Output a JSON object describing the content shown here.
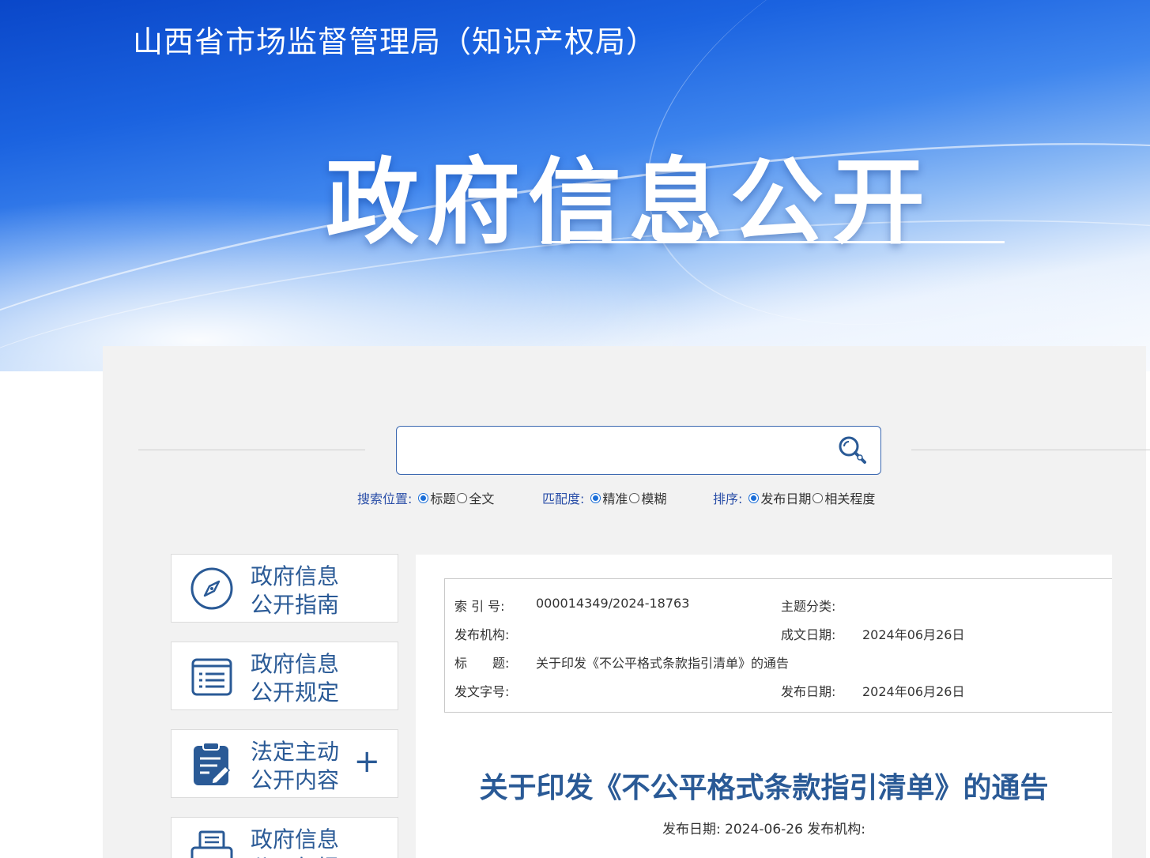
{
  "header": {
    "site_title": "山西省市场监督管理局（知识产权局）",
    "banner_title": "政府信息公开"
  },
  "search": {
    "placeholder": "",
    "position_label": "搜索位置:",
    "position_options": [
      "标题",
      "全文"
    ],
    "position_selected": "标题",
    "match_label": "匹配度:",
    "match_options": [
      "精准",
      "模糊"
    ],
    "match_selected": "精准",
    "sort_label": "排序:",
    "sort_options": [
      "发布日期",
      "相关程度"
    ],
    "sort_selected": "发布日期"
  },
  "sidebar": {
    "items": [
      {
        "label": "政府信息公开指南",
        "icon": "compass-icon"
      },
      {
        "label": "政府信息公开规定",
        "icon": "list-document-icon"
      },
      {
        "label": "法定主动公开内容",
        "icon": "clipboard-edit-icon",
        "expand": "+"
      },
      {
        "label": "政府信息公开年报",
        "icon": "printer-icon"
      }
    ]
  },
  "meta": {
    "index_label": "索 引 号:",
    "index_value": "000014349/2024-18763",
    "topic_label": "主题分类:",
    "topic_value": "",
    "issuer_label": "发布机构:",
    "issuer_value": "",
    "created_label": "成文日期:",
    "created_value": "2024年06月26日",
    "title_label": "标　　题:",
    "title_value": "关于印发《不公平格式条款指引清单》的通告",
    "docno_label": "发文字号:",
    "docno_value": "",
    "published_label": "发布日期:",
    "published_value": "2024年06月26日"
  },
  "article": {
    "title": "关于印发《不公平格式条款指引清单》的通告",
    "meta_line": "发布日期: 2024-06-26 发布机构:"
  },
  "colors": {
    "brand_blue": "#2a5a96",
    "link_blue": "#2b4fa8",
    "banner_blue": "#1b63e0"
  }
}
